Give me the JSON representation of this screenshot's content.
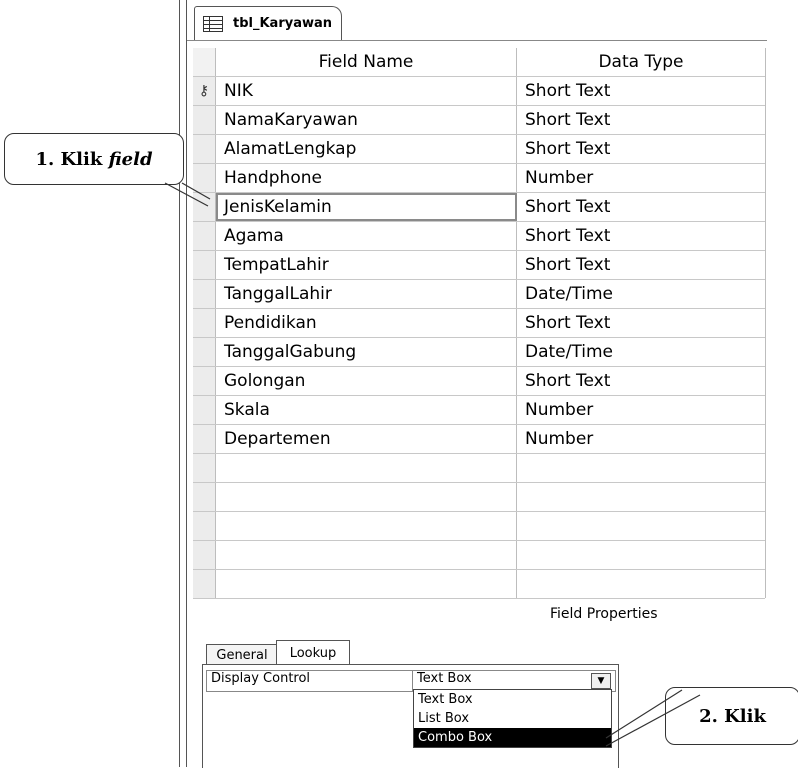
{
  "tab": {
    "title": "tbl_Karyawan",
    "icon": "table-icon"
  },
  "grid": {
    "headers": {
      "field_name": "Field Name",
      "data_type": "Data Type"
    },
    "rows": [
      {
        "name": "NIK",
        "type": "Short Text",
        "key": true
      },
      {
        "name": "NamaKaryawan",
        "type": "Short Text"
      },
      {
        "name": "AlamatLengkap",
        "type": "Short Text"
      },
      {
        "name": "Handphone",
        "type": "Number"
      },
      {
        "name": "JenisKelamin",
        "type": "Short Text",
        "active": true
      },
      {
        "name": "Agama",
        "type": "Short Text"
      },
      {
        "name": "TempatLahir",
        "type": "Short Text"
      },
      {
        "name": "TanggalLahir",
        "type": "Date/Time"
      },
      {
        "name": "Pendidikan",
        "type": "Short Text"
      },
      {
        "name": "TanggalGabung",
        "type": "Date/Time"
      },
      {
        "name": "Golongan",
        "type": "Short Text"
      },
      {
        "name": "Skala",
        "type": "Number"
      },
      {
        "name": "Departemen",
        "type": "Number"
      },
      {
        "name": "",
        "type": ""
      },
      {
        "name": "",
        "type": ""
      },
      {
        "name": "",
        "type": ""
      },
      {
        "name": "",
        "type": ""
      },
      {
        "name": "",
        "type": ""
      }
    ]
  },
  "field_properties": {
    "title": "Field Properties",
    "tabs": {
      "general": "General",
      "lookup": "Lookup"
    },
    "display_control_label": "Display Control",
    "display_control_value": "Text Box",
    "options": [
      "Text Box",
      "List Box",
      "Combo Box"
    ],
    "selected_option": "Combo Box"
  },
  "callouts": {
    "step1_prefix": "1. Klik ",
    "step1_em": "field",
    "step2": "2. Klik"
  }
}
